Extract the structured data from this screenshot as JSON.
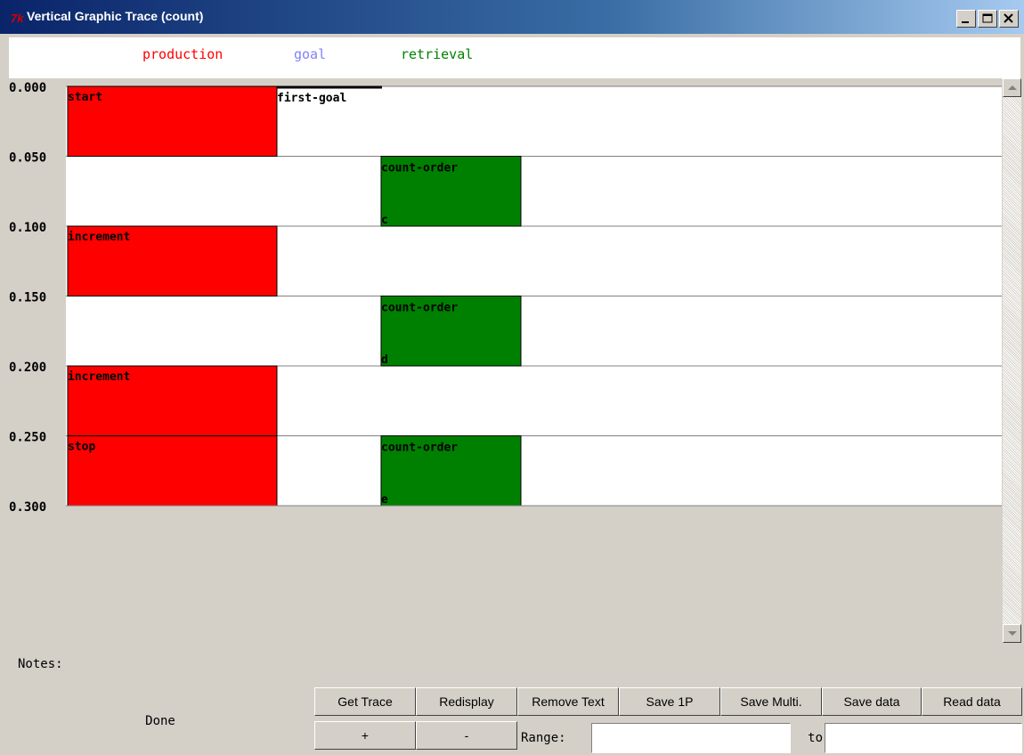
{
  "window": {
    "title": "Vertical Graphic Trace (count)",
    "icon_text": "7k"
  },
  "legend": [
    {
      "label": "production",
      "color": "#ff0000"
    },
    {
      "label": "goal",
      "color": "#8080ff"
    },
    {
      "label": "retrieval",
      "color": "#008000"
    }
  ],
  "colors": {
    "production": "#ff0000",
    "retrieval": "#008000",
    "goal_line": "#000000"
  },
  "trace": {
    "time_ticks": [
      "0.000",
      "0.050",
      "0.100",
      "0.150",
      "0.200",
      "0.250",
      "0.300"
    ],
    "productions": [
      {
        "label": "start",
        "start": 0.0,
        "end": 0.05
      },
      {
        "label": "increment",
        "start": 0.1,
        "end": 0.15
      },
      {
        "label": "increment",
        "start": 0.2,
        "end": 0.25
      },
      {
        "label": "stop",
        "start": 0.25,
        "end": 0.3
      }
    ],
    "goals": [
      {
        "label": "first-goal",
        "time": 0.0
      }
    ],
    "retrievals": [
      {
        "label": "count-order",
        "result": "c",
        "start": 0.05,
        "end": 0.1
      },
      {
        "label": "count-order",
        "result": "d",
        "start": 0.15,
        "end": 0.2
      },
      {
        "label": "count-order",
        "result": "e",
        "start": 0.25,
        "end": 0.3
      }
    ]
  },
  "notes_label": "Notes:",
  "status": "Done",
  "buttons_row1": [
    "Get Trace",
    "Redisplay",
    "Remove Text",
    "Save 1P",
    "Save Multi.",
    "Save data",
    "Read data"
  ],
  "buttons_row2": {
    "zoom_in": "+",
    "zoom_out": "-"
  },
  "range": {
    "label": "Range:",
    "from": "",
    "to_label": "to",
    "to": ""
  }
}
